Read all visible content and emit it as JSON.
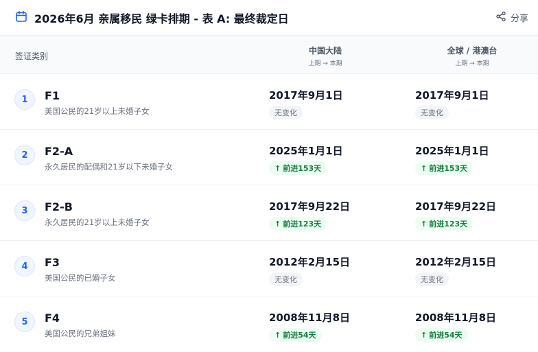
{
  "header": {
    "title": "2026年6月 亲属移民 绿卡排期 - 表 A: 最终裁定日",
    "share_label": "分享",
    "calendar_icon": "calendar-icon",
    "share_icon": "share-icon"
  },
  "table": {
    "category_header": "签证类别",
    "columns": [
      {
        "name": "中国大陆",
        "sub": "上期 → 本期"
      },
      {
        "name": "全球 / 港澳台",
        "sub": "上期 → 本期"
      }
    ],
    "rows": [
      {
        "num": "1",
        "code": "F1",
        "desc": "美国公民的21岁以上未婚子女",
        "c1": {
          "date": "2017年9月1日",
          "badge": "无变化",
          "status": "none"
        },
        "c2": {
          "date": "2017年9月1日",
          "badge": "无变化",
          "status": "none"
        }
      },
      {
        "num": "2",
        "code": "F2-A",
        "desc": "永久居民的配偶和21岁以下未婚子女",
        "c1": {
          "date": "2025年1月1日",
          "badge": "前进153天",
          "status": "adv"
        },
        "c2": {
          "date": "2025年1月1日",
          "badge": "前进153天",
          "status": "adv"
        }
      },
      {
        "num": "3",
        "code": "F2-B",
        "desc": "永久居民的21岁以上未婚子女",
        "c1": {
          "date": "2017年9月22日",
          "badge": "前进123天",
          "status": "adv"
        },
        "c2": {
          "date": "2017年9月22日",
          "badge": "前进123天",
          "status": "adv"
        }
      },
      {
        "num": "4",
        "code": "F3",
        "desc": "美国公民的已婚子女",
        "c1": {
          "date": "2012年2月15日",
          "badge": "无变化",
          "status": "none"
        },
        "c2": {
          "date": "2012年2月15日",
          "badge": "无变化",
          "status": "none"
        }
      },
      {
        "num": "5",
        "code": "F4",
        "desc": "美国公民的兄弟姐妹",
        "c1": {
          "date": "2008年11月8日",
          "badge": "前进54天",
          "status": "adv"
        },
        "c2": {
          "date": "2008年11月8日",
          "badge": "前进54天",
          "status": "adv"
        }
      }
    ]
  },
  "colors": {
    "accent": "#2563eb",
    "advance_text": "#15803d",
    "advance_bg": "#ecfdf3",
    "neutral_bg": "#f3f4f6"
  }
}
